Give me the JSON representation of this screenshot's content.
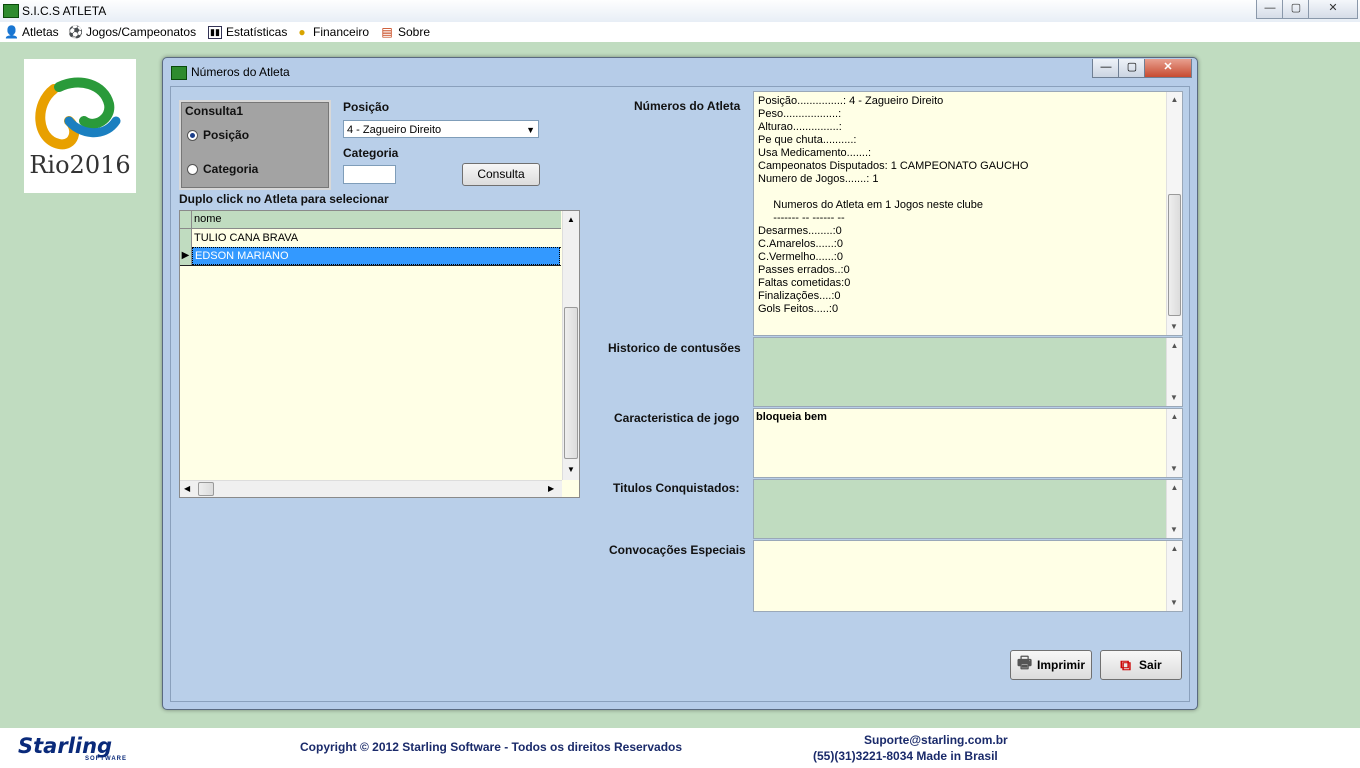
{
  "app": {
    "title": "S.I.C.S ATLETA",
    "accent": "#2e8b2e"
  },
  "window_controls": {
    "minimize": "—",
    "maximize": "▢",
    "close": "✕"
  },
  "menu": [
    {
      "label": "Atletas",
      "icon": "user-icon"
    },
    {
      "label": "Jogos/Campeonatos",
      "icon": "soccer-ball-icon"
    },
    {
      "label": "Estatísticas",
      "icon": "bar-chart-icon"
    },
    {
      "label": "Financeiro",
      "icon": "coins-icon"
    },
    {
      "label": "Sobre",
      "icon": "info-window-icon"
    }
  ],
  "logo": {
    "text": "Rio2016"
  },
  "child": {
    "title": "Números do Atleta",
    "consulta_group": {
      "title": "Consulta1",
      "option_posicao": "Posição",
      "option_categoria": "Categoria",
      "selected": "Posição"
    },
    "posicao_label": "Posição",
    "posicao_value": "4 - Zagueiro Direito",
    "categoria_label": "Categoria",
    "categoria_value": "",
    "consulta_button": "Consulta",
    "instruction": "Duplo click no Atleta para selecionar",
    "grid": {
      "column": "nome",
      "rows": [
        "TULIO CANA BRAVA",
        "EDSON MARIANO"
      ],
      "selected_index": 1
    },
    "numeros_label": "Números do Atleta",
    "numeros_lines": [
      "Posição...............: 4 - Zagueiro Direito",
      "Peso..................:",
      "Alturao...............:",
      "Pe que chuta..........:",
      "Usa Medicamento.......:",
      "Campeonatos Disputados: 1 CAMPEONATO GAUCHO",
      "Numero de Jogos.......: 1",
      "",
      "     Numeros do Atleta em 1 Jogos neste clube",
      "     ------- -- ------ --",
      "Desarmes........:0",
      "C.Amarelos......:0",
      "C.Vermelho......:0",
      "Passes errados..:0",
      "Faltas cometidas:0",
      "Finalizações....:0",
      "Gols Feitos.....:0"
    ],
    "historico_label": "Historico de contusões",
    "historico_value": "",
    "caracteristica_label": "Caracteristica de jogo",
    "caracteristica_value": "bloqueia bem",
    "titulos_label": "Titulos Conquistados:",
    "titulos_value": "",
    "convocacoes_label": "Convocações Especiais",
    "convocacoes_value": "",
    "imprimir_button": "Imprimir",
    "sair_button": "Sair"
  },
  "footer": {
    "brand": "Starling",
    "brand_sub": "SOFTWARE",
    "copyright": "Copyright © 2012 Starling Software - Todos os direitos Reservados",
    "email": "Suporte@starling.com.br",
    "phone": "(55)(31)3221-8034 Made in Brasil"
  }
}
